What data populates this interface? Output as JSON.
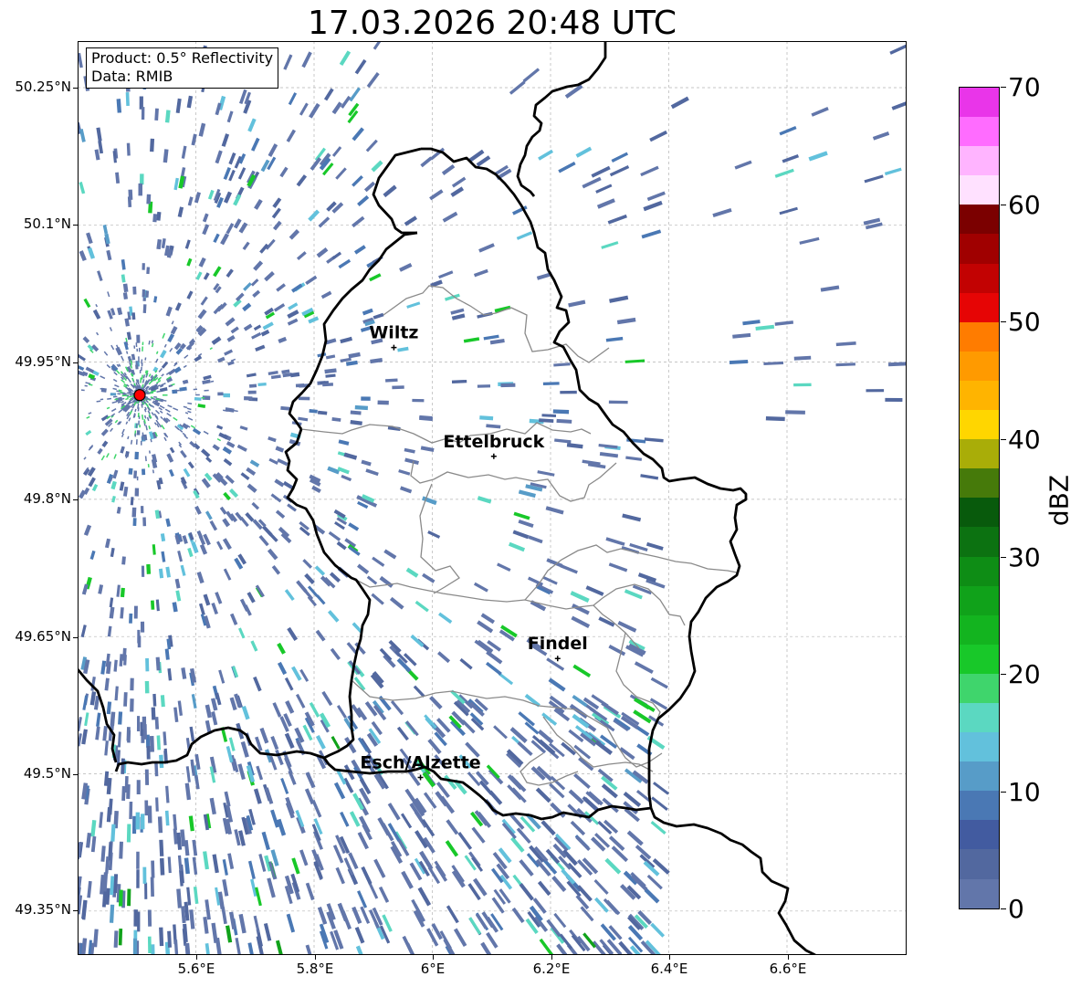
{
  "title": "17.03.2026 20:48 UTC",
  "info": {
    "product": "Product: 0.5° Reflectivity",
    "data": "Data: RMIB"
  },
  "lat_labels": [
    "50.25°N",
    "50.1°N",
    "49.95°N",
    "49.8°N",
    "49.65°N",
    "49.5°N",
    "49.35°N"
  ],
  "lon_labels": [
    "5.6°E",
    "5.8°E",
    "6°E",
    "6.2°E",
    "6.4°E",
    "6.6°E"
  ],
  "cities": [
    {
      "name": "Wiltz",
      "lon": 5.935,
      "lat": 49.966
    },
    {
      "name": "Ettelbruck",
      "lon": 6.104,
      "lat": 49.847
    },
    {
      "name": "Findel",
      "lon": 6.212,
      "lat": 49.626
    },
    {
      "name": "Esch/Alzette",
      "lon": 5.98,
      "lat": 49.496
    }
  ],
  "radar_site": {
    "lon": 5.505,
    "lat": 49.914
  },
  "colorbar": {
    "label": "dBZ",
    "tick_labels": [
      "0",
      "10",
      "20",
      "30",
      "40",
      "50",
      "60",
      "70"
    ],
    "range": [
      0,
      70
    ],
    "step": 2.5,
    "colors": [
      "#6276aa",
      "#52689f",
      "#425ba0",
      "#4a78b4",
      "#579cc8",
      "#62c1dc",
      "#5bd8c1",
      "#3fd56c",
      "#18c829",
      "#13b41f",
      "#10a21a",
      "#0e8d15",
      "#0c7211",
      "#085a0c",
      "#467a0a",
      "#a9ad08",
      "#ffd600",
      "#ffb400",
      "#ff9a00",
      "#ff7c00",
      "#e60505",
      "#c20202",
      "#a00000",
      "#7b0000",
      "#ffe1ff",
      "#ffb4ff",
      "#ff6cff",
      "#e935e9"
    ]
  },
  "colors": {
    "border": "#000000",
    "canton_lines": "#8a8a8a",
    "grid": "#b4b4b4",
    "radar_marker": "#ff0000"
  }
}
